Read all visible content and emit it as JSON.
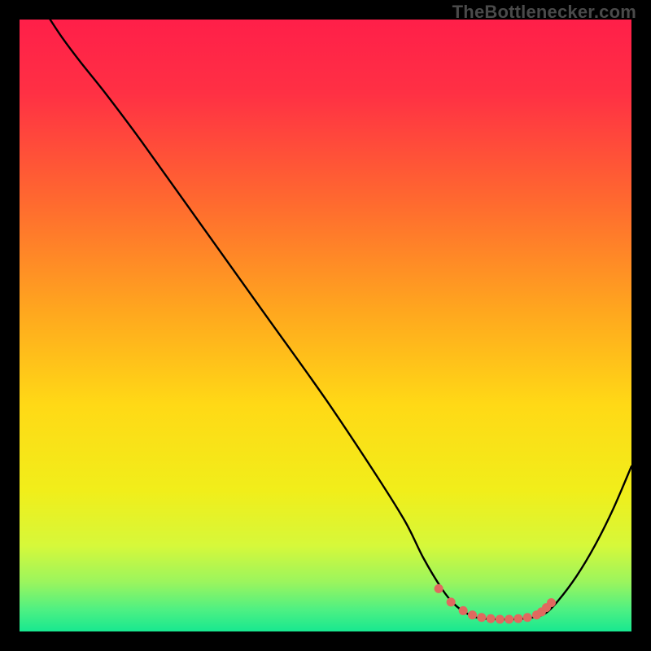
{
  "watermark": "TheBottlenecker.com",
  "chart_data": {
    "type": "line",
    "title": "",
    "xlabel": "",
    "ylabel": "",
    "xlim": [
      0,
      100
    ],
    "ylim": [
      0,
      100
    ],
    "series": [
      {
        "name": "curve",
        "x": [
          5,
          7,
          10,
          14,
          20,
          30,
          40,
          50,
          58,
          63,
          66,
          69,
          71,
          73,
          75,
          78,
          81,
          84,
          86,
          88,
          91,
          94,
          97,
          100
        ],
        "y": [
          100,
          97,
          93,
          88,
          80,
          66,
          52,
          38,
          26,
          18,
          12,
          7,
          4.5,
          3,
          2.2,
          2.0,
          2.0,
          2.3,
          3,
          5,
          9,
          14,
          20,
          27
        ]
      },
      {
        "name": "dots",
        "x": [
          68.5,
          70.5,
          72.5,
          74.0,
          75.5,
          77.0,
          78.5,
          80.0,
          81.5,
          83.0,
          84.5,
          85.3,
          86.1,
          86.9
        ],
        "y": [
          7.0,
          4.8,
          3.4,
          2.7,
          2.3,
          2.1,
          2.0,
          2.0,
          2.1,
          2.3,
          2.7,
          3.2,
          3.9,
          4.7
        ]
      }
    ],
    "gradient_stops": [
      {
        "offset": 0.0,
        "color": "#ff1f49"
      },
      {
        "offset": 0.12,
        "color": "#ff3044"
      },
      {
        "offset": 0.3,
        "color": "#ff6a2f"
      },
      {
        "offset": 0.48,
        "color": "#ffa81e"
      },
      {
        "offset": 0.63,
        "color": "#ffd916"
      },
      {
        "offset": 0.77,
        "color": "#f1ee1a"
      },
      {
        "offset": 0.86,
        "color": "#d6f83a"
      },
      {
        "offset": 0.92,
        "color": "#9af55e"
      },
      {
        "offset": 0.965,
        "color": "#4df083"
      },
      {
        "offset": 1.0,
        "color": "#18e890"
      }
    ],
    "dot_color": "#e0695f",
    "curve_color": "#000000"
  }
}
